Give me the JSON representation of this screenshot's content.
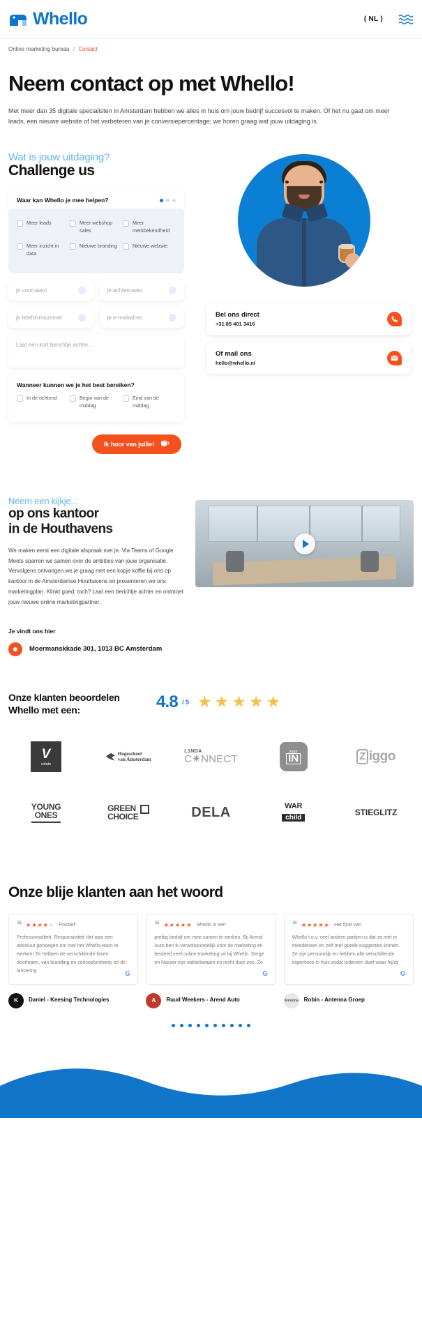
{
  "header": {
    "logo_text": "Whello",
    "lang": "( NL )",
    "menu_icon": "hamburger-waves-icon"
  },
  "breadcrumb": {
    "parent": "Online marketing bureau",
    "separator": "/",
    "current": "Contact"
  },
  "hero": {
    "title": "Neem contact op met Whello!",
    "paragraph": "Met meer dan 35 digitale specialisten in Amsterdam hebben we alles in huis om jouw bedrijf succesvol te maken. Of het nu gaat om meer leads, een nieuwe website of het verbeteren van je conversiepercentage; we horen graag wat jouw uitdaging is."
  },
  "challenge": {
    "eyebrow": "Wat is jouw uitdaging?",
    "title": "Challenge us",
    "form": {
      "question": "Waar kan Whello je mee helpen?",
      "options": [
        "Meer leads",
        "Meer webshop sales",
        "Meer merkbekendheid",
        "Meer inzicht in data",
        "Nieuwe branding",
        "Nieuwe website"
      ],
      "fields": {
        "firstname": "je voornaam",
        "lastname": "je achternaam",
        "phone": "je telefoonnummer",
        "email": "je e-mailadres",
        "message": "Laat een kort berichtje achter..."
      },
      "when_question": "Wanneer kunnen we je het best bereiken?",
      "when_options": [
        "In de ochtend",
        "Begin van de middag",
        "Eind van de middag"
      ],
      "submit": "Ik hoor van jullie!",
      "submit_icon": "coffee-cup-icon"
    },
    "contact_cards": [
      {
        "title": "Bel ons direct",
        "value": "+31 85 401 3416",
        "icon": "phone-icon"
      },
      {
        "title": "Of mail ons",
        "value": "hello@whello.nl",
        "icon": "mail-icon"
      }
    ]
  },
  "office": {
    "eyebrow": "Neem een kijkje...",
    "title_line1": "op ons kantoor",
    "title_line2": "in de Houthavens",
    "paragraph": "We maken eerst een digitale afspraak met je. Via Teams of Google Meets sparren we samen over de ambities van jouw organisatie. Vervolgens ontvangen we je graag met een kopje koffie bij ons op kantoor in de Amsterdamse Houthavens en presenteren we ons marketingplan. Klinkt goed, toch? Laat een berichtje achter en ontmoet jouw nieuwe online marketingpartner.",
    "find_label": "Je vindt ons hier",
    "address": "Moermanskkade 301, 1013 BC Amsterdam"
  },
  "rating": {
    "heading": "Onze klanten beoordelen Whello met een:",
    "score": "4.8",
    "out_of": "/ 5",
    "stars_filled": 4,
    "stars_half": 1
  },
  "logos": {
    "row1": [
      "vidate",
      "Hogeschool van Amsterdam",
      "LINDA CONNECT",
      "JUST IN",
      "Ziggo"
    ],
    "row2": [
      "YOUNG ONES",
      "GREEN CHOICE",
      "DELA",
      "WAR child",
      "STIEGLITZ"
    ],
    "vidate": {
      "mark": "V",
      "name": "vidate"
    },
    "hva": {
      "line1": "Hogeschool",
      "line2": "van Amsterdam"
    },
    "linda": {
      "top": "L1NDA",
      "bottom": "C✷NNECT"
    },
    "justin": {
      "small": "JUST",
      "big": "IN"
    },
    "ziggo": {
      "first": "Z",
      "rest": "iggo"
    },
    "young": {
      "line1": "YOUNG",
      "line2": "ONES"
    },
    "green": {
      "line1": "GREEN",
      "line2": "CHOICE"
    },
    "dela": "DELA",
    "war": {
      "line1": "WAR",
      "line2": "child"
    },
    "stieglitz": "STIEGLITZ"
  },
  "testimonials": {
    "title": "Onze blije klanten aan het woord",
    "cards": [
      {
        "stars": 4,
        "label": "Positief:",
        "body": "Professionaliteit, Responsiviteit Het was een absoluut genoegen om met het Whello-team te werken! Ze hebben de verschillende fasen doorlopen, van branding en conceptontwerp tot de lancering",
        "source": "G"
      },
      {
        "stars": 5,
        "label": "Whello is een",
        "body": "prettig bedrijf om mee samen te werken. Bij Arend Auto ben ik verantwoordelijk voor de marketing en besteed veel online marketing uit bij Whello. Serge en Nasser zijn vakbekwaam en recht door zee. Ze",
        "source": "G"
      },
      {
        "stars": 5,
        "label": "Het fijne van",
        "body": "Whello t.o.v. veel andere partijen is dat ze met je meedenken en zelf met goede suggesties komen. Ze zijn persoonlijk en hebben alle verschillende expertises in huis zodat iedereen doet waar hij/zij",
        "source": "G"
      }
    ],
    "authors": [
      {
        "name": "Daniel - Keesing Technologies",
        "avatar": "K"
      },
      {
        "name": "Ruud Weekers - Arend Auto",
        "avatar": "A"
      },
      {
        "name": "Robin - Antenna Groep",
        "avatar": "Antenna"
      }
    ],
    "pager_count": 10
  },
  "colors": {
    "brand_blue": "#1175c9",
    "accent_orange": "#f4511e",
    "light_blue": "#64b5e8",
    "star_yellow": "#f3c24e"
  }
}
